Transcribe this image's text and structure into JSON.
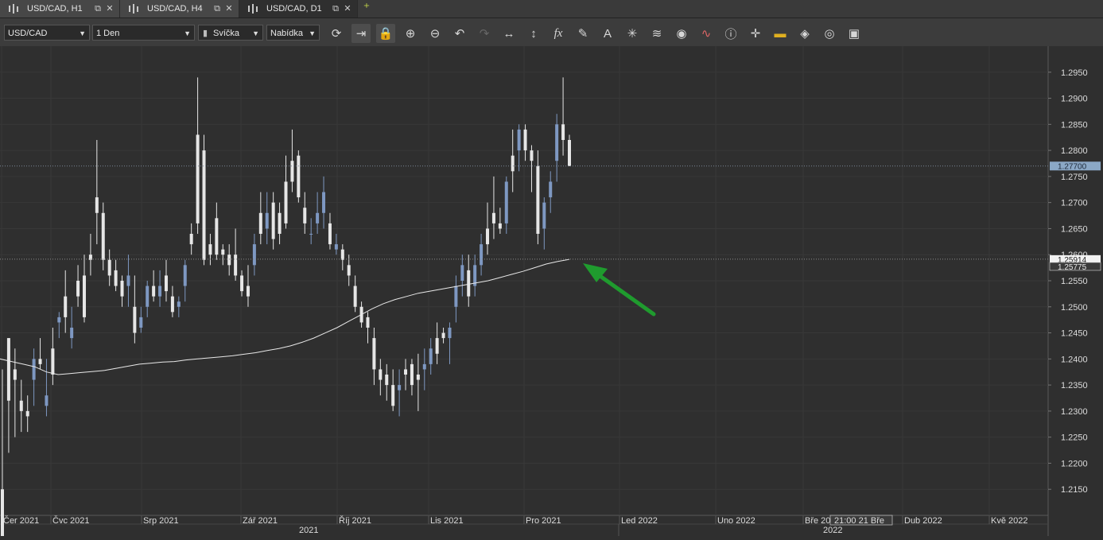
{
  "tabs": [
    {
      "label": "USD/CAD, H1",
      "active": false
    },
    {
      "label": "USD/CAD, H4",
      "active": false
    },
    {
      "label": "USD/CAD, D1",
      "active": true
    }
  ],
  "toolbar": {
    "symbol": "USD/CAD",
    "timeframe": "1 Den",
    "chart_type": "Svíčka",
    "price_side": "Nabídka",
    "icons": [
      "refresh-icon",
      "autoscroll-icon",
      "lock-icon",
      "zoom-in-icon",
      "zoom-out-icon",
      "undo-icon",
      "redo-icon",
      "horizontal-scale-icon",
      "vertical-scale-icon",
      "indicators-fx-icon",
      "pencil-icon",
      "text-tool-icon",
      "crosshair-star-icon",
      "layers-icon",
      "eye-icon",
      "chart-wave-icon",
      "info-icon",
      "crosshair-icon",
      "color-bar-icon",
      "fill-bucket-icon",
      "circle-icon",
      "save-icon"
    ]
  },
  "chart_data": {
    "type": "candlestick",
    "symbol": "USD/CAD",
    "timeframe": "D1",
    "ylim": [
      1.21,
      1.3
    ],
    "y_ticks": [
      "1.2950",
      "1.2900",
      "1.2850",
      "1.2800",
      "1.2750",
      "1.2700",
      "1.2650",
      "1.2600",
      "1.2550",
      "1.2500",
      "1.2450",
      "1.2400",
      "1.2350",
      "1.2300",
      "1.2250",
      "1.2200",
      "1.2150"
    ],
    "price_labels": {
      "bid": "1.27700",
      "ma_a": "1.25914",
      "ma_b": "1.25775"
    },
    "x_labels": [
      "Čer 2021",
      "Čvc 2021",
      "Srp 2021",
      "Zář 2021",
      "Říj 2021",
      "Lis 2021",
      "Pro 2021",
      "Led 2022",
      "Uno 2022",
      "Bře 2022",
      "Dub 2022",
      "Kvě 2022"
    ],
    "cursor_label": "21:00 21 Bře",
    "year_labels": [
      "2021",
      "2022"
    ],
    "candles": [
      [
        1.215,
        1.238,
        1.207,
        1.205
      ],
      [
        1.244,
        1.244,
        1.222,
        1.232
      ],
      [
        1.238,
        1.242,
        1.225,
        1.236
      ],
      [
        1.232,
        1.236,
        1.226,
        1.23
      ],
      [
        1.23,
        1.233,
        1.226,
        1.229
      ],
      [
        1.236,
        1.242,
        1.231,
        1.24
      ],
      [
        1.24,
        1.244,
        1.238,
        1.239
      ],
      [
        1.231,
        1.24,
        1.229,
        1.233
      ],
      [
        1.242,
        1.246,
        1.235,
        1.237
      ],
      [
        1.247,
        1.249,
        1.244,
        1.248
      ],
      [
        1.252,
        1.257,
        1.245,
        1.248
      ],
      [
        1.244,
        1.25,
        1.242,
        1.246
      ],
      [
        1.255,
        1.258,
        1.25,
        1.252
      ],
      [
        1.256,
        1.26,
        1.247,
        1.248
      ],
      [
        1.26,
        1.264,
        1.256,
        1.259
      ],
      [
        1.271,
        1.282,
        1.262,
        1.268
      ],
      [
        1.268,
        1.27,
        1.257,
        1.259
      ],
      [
        1.259,
        1.261,
        1.254,
        1.256
      ],
      [
        1.257,
        1.259,
        1.253,
        1.254
      ],
      [
        1.255,
        1.256,
        1.25,
        1.252
      ],
      [
        1.254,
        1.26,
        1.25,
        1.256
      ],
      [
        1.25,
        1.256,
        1.243,
        1.245
      ],
      [
        1.246,
        1.25,
        1.245,
        1.248
      ],
      [
        1.25,
        1.255,
        1.248,
        1.254
      ],
      [
        1.254,
        1.257,
        1.251,
        1.252
      ],
      [
        1.252,
        1.257,
        1.25,
        1.254
      ],
      [
        1.256,
        1.259,
        1.251,
        1.253
      ],
      [
        1.252,
        1.254,
        1.248,
        1.249
      ],
      [
        1.25,
        1.252,
        1.248,
        1.251
      ],
      [
        1.254,
        1.259,
        1.251,
        1.258
      ],
      [
        1.264,
        1.266,
        1.26,
        1.262
      ],
      [
        1.283,
        1.294,
        1.264,
        1.266
      ],
      [
        1.28,
        1.283,
        1.258,
        1.259
      ],
      [
        1.262,
        1.264,
        1.258,
        1.26
      ],
      [
        1.267,
        1.27,
        1.259,
        1.26
      ],
      [
        1.261,
        1.262,
        1.258,
        1.26
      ],
      [
        1.26,
        1.262,
        1.256,
        1.258
      ],
      [
        1.26,
        1.265,
        1.255,
        1.256
      ],
      [
        1.256,
        1.257,
        1.252,
        1.253
      ],
      [
        1.254,
        1.258,
        1.25,
        1.252
      ],
      [
        1.258,
        1.264,
        1.256,
        1.262
      ],
      [
        1.268,
        1.272,
        1.262,
        1.264
      ],
      [
        1.265,
        1.272,
        1.262,
        1.268
      ],
      [
        1.27,
        1.272,
        1.261,
        1.263
      ],
      [
        1.268,
        1.27,
        1.262,
        1.264
      ],
      [
        1.274,
        1.279,
        1.265,
        1.266
      ],
      [
        1.278,
        1.284,
        1.272,
        1.274
      ],
      [
        1.279,
        1.28,
        1.27,
        1.271
      ],
      [
        1.269,
        1.272,
        1.264,
        1.266
      ],
      [
        1.264,
        1.267,
        1.262,
        1.264
      ],
      [
        1.266,
        1.272,
        1.264,
        1.268
      ],
      [
        1.268,
        1.275,
        1.265,
        1.272
      ],
      [
        1.266,
        1.268,
        1.261,
        1.262
      ],
      [
        1.261,
        1.264,
        1.26,
        1.262
      ],
      [
        1.261,
        1.262,
        1.257,
        1.259
      ],
      [
        1.258,
        1.26,
        1.254,
        1.256
      ],
      [
        1.254,
        1.256,
        1.249,
        1.25
      ],
      [
        1.25,
        1.251,
        1.246,
        1.247
      ],
      [
        1.248,
        1.249,
        1.243,
        1.246
      ],
      [
        1.244,
        1.246,
        1.235,
        1.238
      ],
      [
        1.238,
        1.24,
        1.233,
        1.236
      ],
      [
        1.237,
        1.239,
        1.232,
        1.235
      ],
      [
        1.235,
        1.238,
        1.23,
        1.231
      ],
      [
        1.234,
        1.238,
        1.229,
        1.235
      ],
      [
        1.238,
        1.24,
        1.234,
        1.237
      ],
      [
        1.239,
        1.24,
        1.233,
        1.235
      ],
      [
        1.237,
        1.241,
        1.23,
        1.236
      ],
      [
        1.238,
        1.242,
        1.234,
        1.239
      ],
      [
        1.239,
        1.244,
        1.237,
        1.242
      ],
      [
        1.244,
        1.247,
        1.239,
        1.241
      ],
      [
        1.245,
        1.246,
        1.243,
        1.244
      ],
      [
        1.244,
        1.247,
        1.239,
        1.246
      ],
      [
        1.25,
        1.256,
        1.247,
        1.254
      ],
      [
        1.255,
        1.26,
        1.252,
        1.258
      ],
      [
        1.257,
        1.26,
        1.25,
        1.252
      ],
      [
        1.254,
        1.26,
        1.252,
        1.258
      ],
      [
        1.258,
        1.264,
        1.256,
        1.262
      ],
      [
        1.265,
        1.27,
        1.26,
        1.262
      ],
      [
        1.268,
        1.275,
        1.263,
        1.266
      ],
      [
        1.266,
        1.269,
        1.264,
        1.265
      ],
      [
        1.266,
        1.275,
        1.264,
        1.274
      ],
      [
        1.279,
        1.284,
        1.272,
        1.276
      ],
      [
        1.28,
        1.285,
        1.276,
        1.284
      ],
      [
        1.284,
        1.285,
        1.278,
        1.28
      ],
      [
        1.28,
        1.281,
        1.272,
        1.278
      ],
      [
        1.277,
        1.28,
        1.262,
        1.264
      ],
      [
        1.265,
        1.271,
        1.261,
        1.27
      ],
      [
        1.271,
        1.276,
        1.268,
        1.274
      ],
      [
        1.278,
        1.287,
        1.274,
        1.285
      ],
      [
        1.285,
        1.294,
        1.279,
        1.282
      ],
      [
        1.282,
        1.283,
        1.277,
        1.277
      ]
    ],
    "moving_average": [
      1.24,
      1.2395,
      1.239,
      1.2385,
      1.2375,
      1.237,
      1.2372,
      1.2374,
      1.2376,
      1.2378,
      1.2382,
      1.2386,
      1.239,
      1.2392,
      1.2394,
      1.2395,
      1.2398,
      1.24,
      1.2402,
      1.2404,
      1.2406,
      1.2409,
      1.2412,
      1.2416,
      1.242,
      1.2425,
      1.2432,
      1.244,
      1.245,
      1.246,
      1.2472,
      1.2484,
      1.2496,
      1.2506,
      1.2514,
      1.252,
      1.2526,
      1.253,
      1.2534,
      1.2538,
      1.2542,
      1.2546,
      1.255,
      1.2556,
      1.2562,
      1.2568,
      1.2575,
      1.2582,
      1.2587,
      1.2591
    ]
  },
  "annotations": [
    {
      "type": "arrow",
      "color": "#1f9b2e",
      "points_to": "moving-average-end"
    }
  ]
}
